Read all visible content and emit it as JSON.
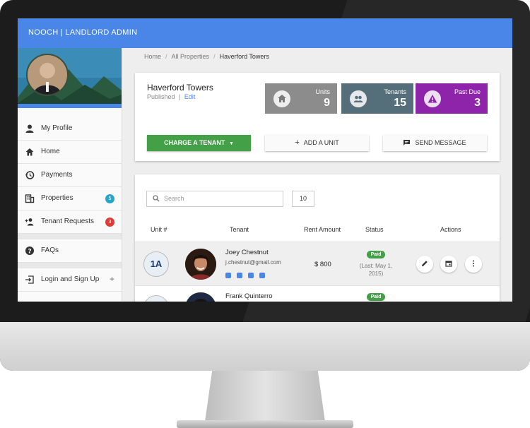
{
  "app": {
    "title": "NOOCH | LANDLORD ADMIN",
    "accent_color": "#4a86e8"
  },
  "sidebar": {
    "items": [
      {
        "label": "My Profile",
        "icon": "person-icon"
      },
      {
        "label": "Home",
        "icon": "home-icon"
      },
      {
        "label": "Payments",
        "icon": "history-icon"
      },
      {
        "label": "Properties",
        "icon": "building-icon",
        "badge": "5",
        "badge_color": "#26a6c9"
      },
      {
        "label": "Tenant Requests",
        "icon": "group-add-icon",
        "badge": "3",
        "badge_color": "#e53935"
      },
      {
        "label": "FAQs",
        "icon": "help-icon"
      },
      {
        "label": "Login and Sign Up",
        "icon": "login-icon",
        "suffix": "+"
      }
    ]
  },
  "breadcrumb": {
    "items": [
      "Home",
      "All Properties"
    ],
    "current": "Haverford Towers",
    "separator": "/"
  },
  "property": {
    "name": "Haverford Towers",
    "status": "Published",
    "divider": "|",
    "edit_label": "Edit"
  },
  "stats": [
    {
      "label": "Units",
      "value": "9",
      "color": "#8c8c8c",
      "icon": "home-icon"
    },
    {
      "label": "Tenants",
      "value": "15",
      "color": "#546e7a",
      "icon": "group-icon"
    },
    {
      "label": "Past Due",
      "value": "3",
      "color": "#8e24aa",
      "icon": "warning-icon"
    }
  ],
  "actions": {
    "charge": "CHARGE A TENANT",
    "add_unit": "ADD A UNIT",
    "add_unit_icon": "+",
    "send_message": "SEND MESSAGE"
  },
  "table": {
    "search_placeholder": "Search",
    "per_page": "10",
    "headers": [
      "Unit #",
      "Tenant",
      "Rent Amount",
      "Status",
      "Actions"
    ],
    "rows": [
      {
        "unit": "1A",
        "name": "Joey Chestnut",
        "email": "j.chestnut@gmail.com",
        "rent": "$ 800",
        "status": "Paid",
        "last_paid": "(Last: May 1, 2015)"
      },
      {
        "unit": "",
        "name": "Frank Quinterro",
        "email": "",
        "rent": "",
        "status": "Paid",
        "last_paid": ""
      }
    ],
    "status_color": "#43a047"
  }
}
